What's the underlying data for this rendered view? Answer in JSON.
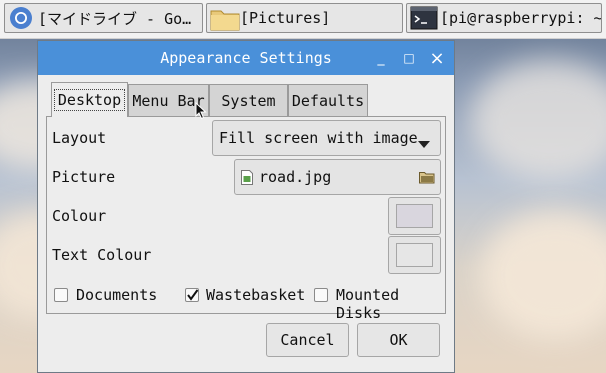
{
  "taskbar": {
    "items": [
      {
        "label": "[マイドライブ - Go…",
        "icon": "chromium-icon"
      },
      {
        "label": "[Pictures]",
        "icon": "folder-icon"
      },
      {
        "label": "[pi@raspberrypi: ~]",
        "icon": "terminal-icon"
      }
    ]
  },
  "dialog": {
    "title": "Appearance Settings",
    "controls": {
      "minimize": "_",
      "maximize": "□",
      "close": "×"
    },
    "tabs": [
      "Desktop",
      "Menu Bar",
      "System",
      "Defaults"
    ],
    "active_tab": "Desktop",
    "layout": {
      "label": "Layout",
      "value": "Fill screen with image"
    },
    "picture": {
      "label": "Picture",
      "value": "road.jpg"
    },
    "colour": {
      "label": "Colour",
      "color": "#d9d6de"
    },
    "text_colour": {
      "label": "Text Colour",
      "color": "#e6e6e6"
    },
    "checkboxes": [
      {
        "label": "Documents",
        "checked": false
      },
      {
        "label": "Wastebasket",
        "checked": true
      },
      {
        "label": "Mounted Disks",
        "checked": false
      }
    ],
    "buttons": {
      "cancel": "Cancel",
      "ok": "OK"
    }
  },
  "colors": {
    "titlebar": "#4a90d9",
    "window_bg": "#ededed"
  }
}
